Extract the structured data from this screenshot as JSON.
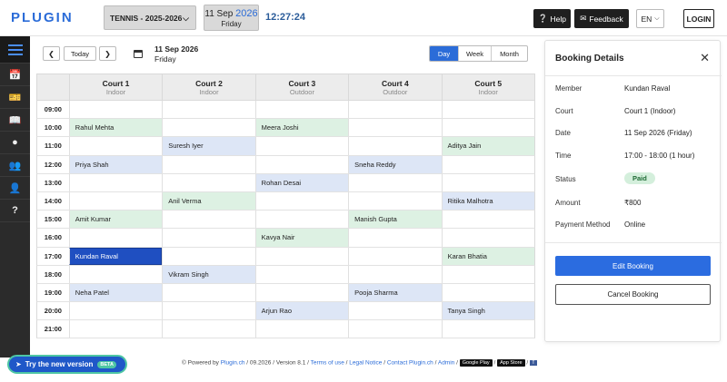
{
  "header": {
    "logo_text": "PLUGIN",
    "season": "TENNIS - 2025-2026",
    "date_day": "11 Sep",
    "date_year": "2026",
    "date_weekday": "Friday",
    "clock": "12:27:24",
    "help_label": "Help",
    "feedback_label": "Feedback",
    "lang_label": "EN",
    "login_label": "LOGIN"
  },
  "sidebar": {
    "items": [
      "menu-icon",
      "calendar-icon",
      "ticket-icon",
      "book-icon",
      "location-icon",
      "users-icon",
      "user-icon",
      "help-icon"
    ]
  },
  "nav": {
    "today_label": "Today",
    "selected_date": "11 Sep 2026",
    "selected_weekday": "Friday",
    "views": [
      "Day",
      "Week",
      "Month"
    ],
    "active_view": "Day"
  },
  "courts": [
    {
      "name": "Court 1",
      "type": "Indoor"
    },
    {
      "name": "Court 2",
      "type": "Indoor"
    },
    {
      "name": "Court 3",
      "type": "Outdoor"
    },
    {
      "name": "Court 4",
      "type": "Outdoor"
    },
    {
      "name": "Court 5",
      "type": "Indoor"
    }
  ],
  "schedule": [
    {
      "time": "09:00",
      "cells": [
        "",
        "",
        "",
        "",
        ""
      ]
    },
    {
      "time": "10:00",
      "cells": [
        "Rahul Mehta",
        "",
        "Meera Joshi",
        "",
        ""
      ]
    },
    {
      "time": "11:00",
      "cells": [
        "",
        "Suresh Iyer",
        "",
        "",
        "Aditya Jain"
      ]
    },
    {
      "time": "12:00",
      "cells": [
        "Priya Shah",
        "",
        "",
        "Sneha Reddy",
        ""
      ]
    },
    {
      "time": "13:00",
      "cells": [
        "",
        "",
        "Rohan Desai",
        "",
        ""
      ]
    },
    {
      "time": "14:00",
      "cells": [
        "",
        "Anil Verma",
        "",
        "",
        "Ritika Malhotra"
      ]
    },
    {
      "time": "15:00",
      "cells": [
        "Amit Kumar",
        "",
        "",
        "Manish Gupta",
        ""
      ]
    },
    {
      "time": "16:00",
      "cells": [
        "",
        "",
        "Kavya Nair",
        "",
        ""
      ]
    },
    {
      "time": "17:00",
      "cells": [
        "Kundan Raval",
        "",
        "",
        "",
        "Karan Bhatia"
      ]
    },
    {
      "time": "18:00",
      "cells": [
        "",
        "Vikram Singh",
        "",
        "",
        ""
      ]
    },
    {
      "time": "19:00",
      "cells": [
        "Neha Patel",
        "",
        "",
        "Pooja Sharma",
        ""
      ]
    },
    {
      "time": "20:00",
      "cells": [
        "",
        "",
        "Arjun Rao",
        "",
        "Tanya Singh"
      ]
    },
    {
      "time": "21:00",
      "cells": [
        "",
        "",
        "",
        "",
        ""
      ]
    }
  ],
  "cell_colors": [
    [
      "",
      "",
      "",
      "",
      ""
    ],
    [
      "green",
      "",
      "green",
      "",
      ""
    ],
    [
      "",
      "blue",
      "",
      "",
      "green"
    ],
    [
      "blue",
      "",
      "",
      "blue",
      ""
    ],
    [
      "",
      "",
      "blue",
      "",
      ""
    ],
    [
      "",
      "green",
      "",
      "",
      "blue"
    ],
    [
      "green",
      "",
      "",
      "green",
      ""
    ],
    [
      "",
      "",
      "green",
      "",
      ""
    ],
    [
      "sel",
      "",
      "",
      "",
      "green"
    ],
    [
      "",
      "blue",
      "",
      "",
      ""
    ],
    [
      "blue",
      "",
      "",
      "blue",
      ""
    ],
    [
      "",
      "",
      "blue",
      "",
      "blue"
    ],
    [
      "",
      "",
      "",
      "",
      ""
    ]
  ],
  "details": {
    "title": "Booking Details",
    "fields": [
      {
        "label": "Member",
        "value": "Kundan Raval"
      },
      {
        "label": "Court",
        "value": "Court 1 (Indoor)"
      },
      {
        "label": "Date",
        "value": "11 Sep 2026 (Friday)"
      },
      {
        "label": "Time",
        "value": "17:00 - 18:00 (1 hour)"
      },
      {
        "label": "Status",
        "value": "Paid"
      },
      {
        "label": "Amount",
        "value": "₹800"
      },
      {
        "label": "Payment Method",
        "value": "Online"
      }
    ],
    "edit_label": "Edit Booking",
    "cancel_label": "Cancel Booking"
  },
  "footer": {
    "powered_prefix": "© Powered by ",
    "powered_link": "Plugin.ch",
    "version_text": " / 09.2026 / Version 8.1 / ",
    "terms": "Terms of use",
    "legal": "Legal Notice",
    "contact": "Contact Plugin.ch",
    "admin": "Admin",
    "google_play": "Google Play",
    "app_store": "App Store",
    "fb": "f"
  },
  "new_version": {
    "label": "Try the new version",
    "badge": "BETA"
  },
  "colors": {
    "accent": "#2b6cd8",
    "booking_green": "#ddf1e3",
    "booking_blue": "#dde6f6",
    "selected": "#1f4fc1"
  }
}
